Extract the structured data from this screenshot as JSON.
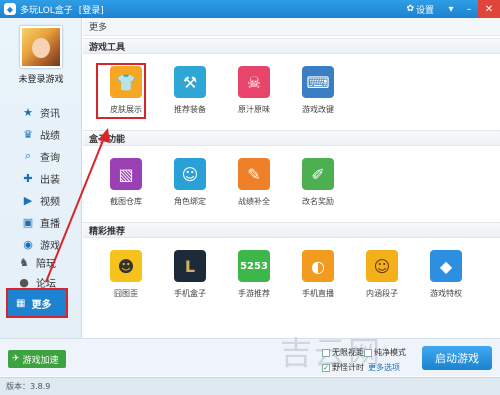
{
  "titlebar": {
    "app_title": "多玩LOL盒子",
    "login_link": "[登录]",
    "settings_label": "设置"
  },
  "sidebar": {
    "user_name": "未登录游戏",
    "items": [
      {
        "label": "资讯",
        "icon": "star-icon"
      },
      {
        "label": "战绩",
        "icon": "trophy-icon"
      },
      {
        "label": "查询",
        "icon": "search-icon"
      },
      {
        "label": "出装",
        "icon": "equipment-icon"
      },
      {
        "label": "视频",
        "icon": "video-icon"
      },
      {
        "label": "直播",
        "icon": "live-icon"
      },
      {
        "label": "游戏",
        "icon": "gamepad-icon"
      },
      {
        "label": "陪玩",
        "icon": "companion-icon"
      },
      {
        "label": "论坛",
        "icon": "forum-icon"
      },
      {
        "label": "更多",
        "icon": "grid-icon"
      }
    ]
  },
  "main": {
    "header": "更多",
    "sections": [
      {
        "title": "游戏工具",
        "tiles": [
          {
            "label": "皮肤展示",
            "color": "#f5a623",
            "icon": "shirt-icon"
          },
          {
            "label": "推荐装备",
            "color": "#2fa7d6",
            "icon": "gear-recommend-icon"
          },
          {
            "label": "原汁原味",
            "color": "#e8456a",
            "icon": "skull-icon"
          },
          {
            "label": "游戏改键",
            "color": "#3a7fc4",
            "icon": "keyboard-icon"
          }
        ]
      },
      {
        "title": "盒子功能",
        "tiles": [
          {
            "label": "截图仓库",
            "color": "#9b3fb5",
            "icon": "screenshot-icon"
          },
          {
            "label": "角色绑定",
            "color": "#2aa0d8",
            "icon": "user-bind-icon"
          },
          {
            "label": "战绩补全",
            "color": "#f07f2a",
            "icon": "record-edit-icon"
          },
          {
            "label": "改名奖励",
            "color": "#4caf50",
            "icon": "rename-reward-icon"
          }
        ]
      },
      {
        "title": "精彩推荐",
        "tiles": [
          {
            "label": "囧图歪",
            "color": "#f7c21c",
            "icon": "funny-face-icon"
          },
          {
            "label": "手机盒子",
            "color": "#1c2a3a",
            "icon": "lol-mobile-icon"
          },
          {
            "label": "手游推荐",
            "color": "#3db64a",
            "icon": "5253-icon"
          },
          {
            "label": "手机直播",
            "color": "#f29b1f",
            "icon": "mobile-live-icon"
          },
          {
            "label": "内涵段子",
            "color": "#f4b01a",
            "icon": "laugh-icon"
          },
          {
            "label": "游戏特权",
            "color": "#2d8fe0",
            "icon": "diamond-icon"
          }
        ]
      }
    ]
  },
  "bottom": {
    "speed_button": "游戏加速",
    "watermark": "吉云网",
    "opt_unlimited": "无限视距",
    "opt_pure": "纯净模式",
    "opt_timer": "野怪计时",
    "more_options": "更多选项",
    "start_button": "启动游戏"
  },
  "status": {
    "version": "版本：3.8.9"
  }
}
